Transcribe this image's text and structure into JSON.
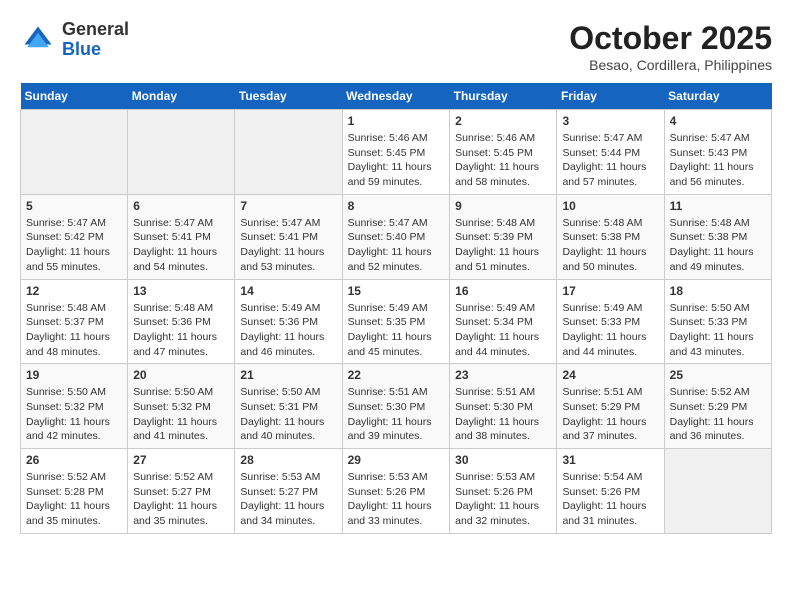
{
  "header": {
    "logo_general": "General",
    "logo_blue": "Blue",
    "month_title": "October 2025",
    "location": "Besao, Cordillera, Philippines"
  },
  "days_of_week": [
    "Sunday",
    "Monday",
    "Tuesday",
    "Wednesday",
    "Thursday",
    "Friday",
    "Saturday"
  ],
  "weeks": [
    [
      {
        "day": "",
        "info": ""
      },
      {
        "day": "",
        "info": ""
      },
      {
        "day": "",
        "info": ""
      },
      {
        "day": "1",
        "info": "Sunrise: 5:46 AM\nSunset: 5:45 PM\nDaylight: 11 hours\nand 59 minutes."
      },
      {
        "day": "2",
        "info": "Sunrise: 5:46 AM\nSunset: 5:45 PM\nDaylight: 11 hours\nand 58 minutes."
      },
      {
        "day": "3",
        "info": "Sunrise: 5:47 AM\nSunset: 5:44 PM\nDaylight: 11 hours\nand 57 minutes."
      },
      {
        "day": "4",
        "info": "Sunrise: 5:47 AM\nSunset: 5:43 PM\nDaylight: 11 hours\nand 56 minutes."
      }
    ],
    [
      {
        "day": "5",
        "info": "Sunrise: 5:47 AM\nSunset: 5:42 PM\nDaylight: 11 hours\nand 55 minutes."
      },
      {
        "day": "6",
        "info": "Sunrise: 5:47 AM\nSunset: 5:41 PM\nDaylight: 11 hours\nand 54 minutes."
      },
      {
        "day": "7",
        "info": "Sunrise: 5:47 AM\nSunset: 5:41 PM\nDaylight: 11 hours\nand 53 minutes."
      },
      {
        "day": "8",
        "info": "Sunrise: 5:47 AM\nSunset: 5:40 PM\nDaylight: 11 hours\nand 52 minutes."
      },
      {
        "day": "9",
        "info": "Sunrise: 5:48 AM\nSunset: 5:39 PM\nDaylight: 11 hours\nand 51 minutes."
      },
      {
        "day": "10",
        "info": "Sunrise: 5:48 AM\nSunset: 5:38 PM\nDaylight: 11 hours\nand 50 minutes."
      },
      {
        "day": "11",
        "info": "Sunrise: 5:48 AM\nSunset: 5:38 PM\nDaylight: 11 hours\nand 49 minutes."
      }
    ],
    [
      {
        "day": "12",
        "info": "Sunrise: 5:48 AM\nSunset: 5:37 PM\nDaylight: 11 hours\nand 48 minutes."
      },
      {
        "day": "13",
        "info": "Sunrise: 5:48 AM\nSunset: 5:36 PM\nDaylight: 11 hours\nand 47 minutes."
      },
      {
        "day": "14",
        "info": "Sunrise: 5:49 AM\nSunset: 5:36 PM\nDaylight: 11 hours\nand 46 minutes."
      },
      {
        "day": "15",
        "info": "Sunrise: 5:49 AM\nSunset: 5:35 PM\nDaylight: 11 hours\nand 45 minutes."
      },
      {
        "day": "16",
        "info": "Sunrise: 5:49 AM\nSunset: 5:34 PM\nDaylight: 11 hours\nand 44 minutes."
      },
      {
        "day": "17",
        "info": "Sunrise: 5:49 AM\nSunset: 5:33 PM\nDaylight: 11 hours\nand 44 minutes."
      },
      {
        "day": "18",
        "info": "Sunrise: 5:50 AM\nSunset: 5:33 PM\nDaylight: 11 hours\nand 43 minutes."
      }
    ],
    [
      {
        "day": "19",
        "info": "Sunrise: 5:50 AM\nSunset: 5:32 PM\nDaylight: 11 hours\nand 42 minutes."
      },
      {
        "day": "20",
        "info": "Sunrise: 5:50 AM\nSunset: 5:32 PM\nDaylight: 11 hours\nand 41 minutes."
      },
      {
        "day": "21",
        "info": "Sunrise: 5:50 AM\nSunset: 5:31 PM\nDaylight: 11 hours\nand 40 minutes."
      },
      {
        "day": "22",
        "info": "Sunrise: 5:51 AM\nSunset: 5:30 PM\nDaylight: 11 hours\nand 39 minutes."
      },
      {
        "day": "23",
        "info": "Sunrise: 5:51 AM\nSunset: 5:30 PM\nDaylight: 11 hours\nand 38 minutes."
      },
      {
        "day": "24",
        "info": "Sunrise: 5:51 AM\nSunset: 5:29 PM\nDaylight: 11 hours\nand 37 minutes."
      },
      {
        "day": "25",
        "info": "Sunrise: 5:52 AM\nSunset: 5:29 PM\nDaylight: 11 hours\nand 36 minutes."
      }
    ],
    [
      {
        "day": "26",
        "info": "Sunrise: 5:52 AM\nSunset: 5:28 PM\nDaylight: 11 hours\nand 35 minutes."
      },
      {
        "day": "27",
        "info": "Sunrise: 5:52 AM\nSunset: 5:27 PM\nDaylight: 11 hours\nand 35 minutes."
      },
      {
        "day": "28",
        "info": "Sunrise: 5:53 AM\nSunset: 5:27 PM\nDaylight: 11 hours\nand 34 minutes."
      },
      {
        "day": "29",
        "info": "Sunrise: 5:53 AM\nSunset: 5:26 PM\nDaylight: 11 hours\nand 33 minutes."
      },
      {
        "day": "30",
        "info": "Sunrise: 5:53 AM\nSunset: 5:26 PM\nDaylight: 11 hours\nand 32 minutes."
      },
      {
        "day": "31",
        "info": "Sunrise: 5:54 AM\nSunset: 5:26 PM\nDaylight: 11 hours\nand 31 minutes."
      },
      {
        "day": "",
        "info": ""
      }
    ]
  ]
}
